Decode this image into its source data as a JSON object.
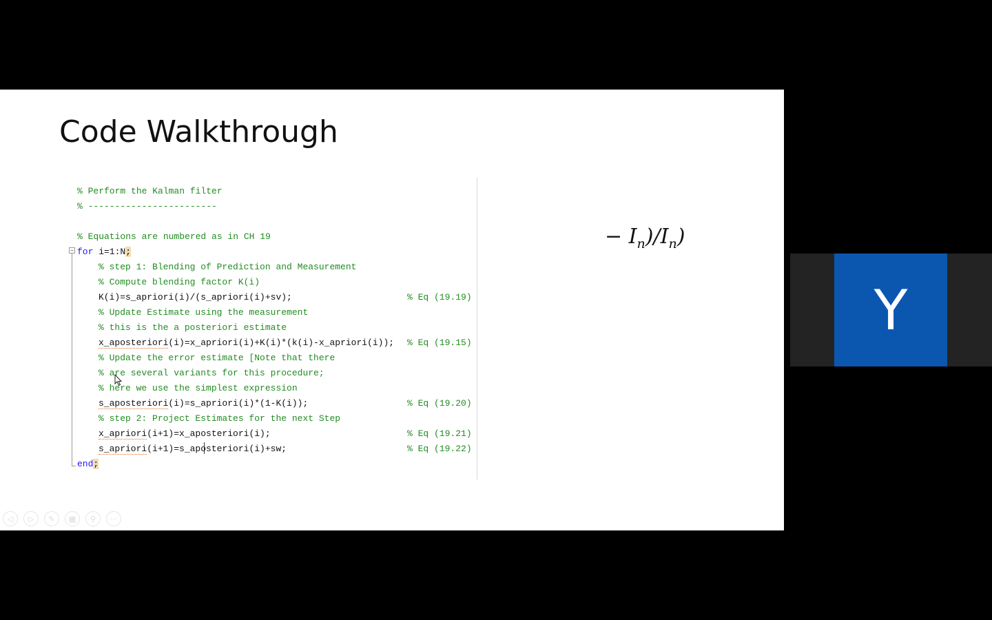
{
  "slide": {
    "title": "Code Walkthrough",
    "code": {
      "line1": "% Perform the Kalman filter",
      "line2": "% ------------------------",
      "line3": "% Equations are numbered as in CH 19",
      "for_kw": "for",
      "for_rest": " i=1:N",
      "semi": ";",
      "line5": "% step 1: Blending of Prediction and Measurement",
      "line6": "% Compute blending factor K(i)",
      "line7": "K(i)=s_apriori(i)/(s_apriori(i)+sv);",
      "line7_eq": "% Eq (19.19)",
      "line8": "% Update Estimate using the measurement",
      "line9": "% this is the a posteriori estimate",
      "line10_a": "x_aposteriori",
      "line10_b": "(i)=x_apriori(i)+K(i)*(k(i)-x_apriori(i));",
      "line10_eq": "% Eq (19.15)",
      "line11": "% Update the error estimate [Note that there",
      "line12": "% are several variants for this procedure;",
      "line13": "% here we use the simplest expression",
      "line14_a": "s_aposteriori",
      "line14_b": "(i)=s_apriori(i)*(1-K(i));",
      "line14_eq": "% Eq (19.20)",
      "line15": "% step 2: Project Estimates for the next Step",
      "line16_a": "x_apriori",
      "line16_b": "(i+1)=x_aposteriori(i);",
      "line16_eq": "% Eq (19.21)",
      "line17_a": "s_apriori",
      "line17_b": "(i+1)=s_aposteriori(i)+sw;",
      "line17_eq": "% Eq (19.22)",
      "end_kw": "end",
      "end_semi": ";"
    },
    "formula": {
      "prefix": "− I",
      "sub1": "n",
      "mid": ")/I",
      "sub2": "n",
      "suffix": ")"
    },
    "controls": [
      {
        "icon": "previous-icon",
        "glyph": "◁"
      },
      {
        "icon": "next-icon",
        "glyph": "▷"
      },
      {
        "icon": "pen-icon",
        "glyph": "✎"
      },
      {
        "icon": "slides-grid-icon",
        "glyph": "▦"
      },
      {
        "icon": "zoom-icon",
        "glyph": "⚲"
      },
      {
        "icon": "more-icon",
        "glyph": "···"
      }
    ]
  },
  "participant": {
    "initial": "Y",
    "avatar_color": "#0b57b0"
  }
}
